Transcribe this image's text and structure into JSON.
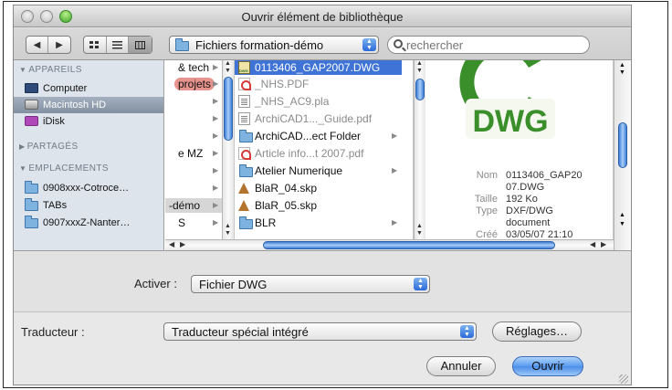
{
  "window": {
    "title": "Ouvrir élément de bibliothèque"
  },
  "toolbar": {
    "back_glyph": "◀",
    "forward_glyph": "▶",
    "view_icons": [
      "icon-view-icon",
      "list-view-icon",
      "column-view-icon"
    ],
    "path_popup": "Fichiers formation-démo",
    "search_placeholder": "rechercher"
  },
  "sidebar": {
    "sections": [
      {
        "label": "APPAREILS",
        "items": [
          "Computer",
          "Macintosh HD",
          "iDisk"
        ]
      },
      {
        "label": "PARTAGÉS",
        "items": []
      },
      {
        "label": "EMPLACEMENTS",
        "items": [
          "0908xxx-Cotroce…",
          "TABs",
          "0907xxxZ-Nanter…"
        ]
      }
    ],
    "selected": "Macintosh HD"
  },
  "column1": {
    "items": [
      "& tech",
      "projets",
      "",
      "",
      "",
      "e MZ",
      "",
      "",
      "-démo",
      "S"
    ],
    "highlighted": "projets",
    "selected": "-démo"
  },
  "column2": {
    "items": [
      {
        "name": "0113406_GAP2007.DWG",
        "icon": "dwg-file-icon",
        "selected": true
      },
      {
        "name": "_NHS.PDF",
        "icon": "pdf-file-icon",
        "faded": true
      },
      {
        "name": "_NHS_AC9.pla",
        "icon": "document-icon",
        "faded": true
      },
      {
        "name": "ArchiCAD1..._Guide.pdf",
        "icon": "document-icon",
        "faded": true
      },
      {
        "name": "ArchiCAD...ect Folder",
        "icon": "folder-icon",
        "faded": false
      },
      {
        "name": "Article info...t 2007.pdf",
        "icon": "pdf-file-icon",
        "faded": true
      },
      {
        "name": "Atelier Numerique",
        "icon": "folder-icon",
        "faded": false
      },
      {
        "name": "BlaR_04.skp",
        "icon": "sketchup-file-icon",
        "faded": false
      },
      {
        "name": "BlaR_05.skp",
        "icon": "sketchup-file-icon",
        "faded": false
      },
      {
        "name": "BLR",
        "icon": "folder-icon",
        "faded": false
      }
    ]
  },
  "preview": {
    "logo_text": "DWG",
    "fields": [
      {
        "key": "Nom",
        "value": "0113406_GAP20"
      },
      {
        "key": "",
        "value": "07.DWG"
      },
      {
        "key": "Taille",
        "value": "192 Ko"
      },
      {
        "key": "Type",
        "value": "DXF/DWG"
      },
      {
        "key": "",
        "value": "document"
      },
      {
        "key": "Créé",
        "value": "03/05/07 21:10"
      }
    ]
  },
  "options": {
    "enable_label": "Activer :",
    "enable_value": "Fichier DWG",
    "translator_label": "Traducteur :",
    "translator_value": "Traducteur spécial intégré",
    "settings_button": "Réglages…"
  },
  "actions": {
    "cancel": "Annuler",
    "open": "Ouvrir"
  },
  "colors": {
    "selection": "#3f74d6",
    "sidebar_bg": "#dee4ec",
    "scroll_thumb": "#3e7fd8",
    "dwg_green": "#3a8f2a"
  }
}
